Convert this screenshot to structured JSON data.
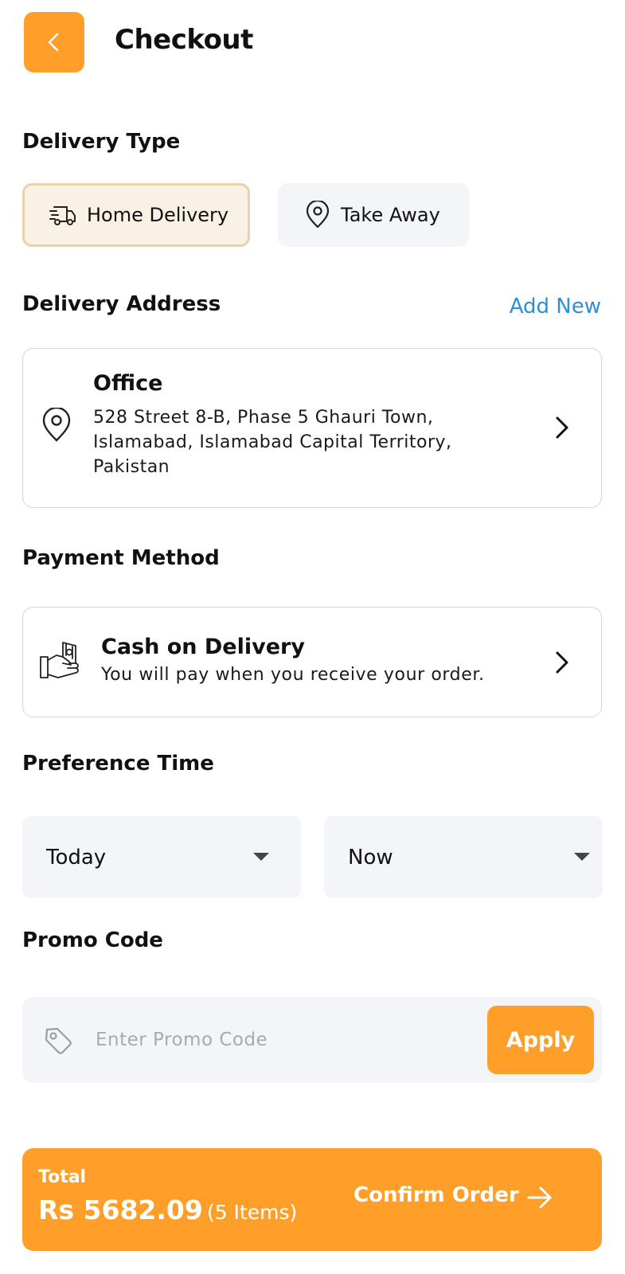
{
  "header": {
    "title": "Checkout"
  },
  "delivery_type": {
    "heading": "Delivery Type",
    "options": [
      {
        "label": "Home Delivery",
        "icon": "delivery-truck-icon",
        "selected": true
      },
      {
        "label": "Take Away",
        "icon": "location-pin-icon",
        "selected": false
      }
    ]
  },
  "delivery_address": {
    "heading": "Delivery Address",
    "add_new": "Add New",
    "name": "Office",
    "line1": "528 Street 8-B, Phase 5 Ghauri Town,",
    "line2": "Islamabad, Islamabad Capital Territory,",
    "line3": "Pakistan"
  },
  "payment": {
    "heading": "Payment Method",
    "title": "Cash on Delivery",
    "description": "You will pay when you receive your order."
  },
  "preference_time": {
    "heading": "Preference Time",
    "day": "Today",
    "time": "Now"
  },
  "promo": {
    "heading": "Promo Code",
    "placeholder": "Enter Promo Code",
    "apply_label": "Apply"
  },
  "footer": {
    "total_label": "Total",
    "total_amount": "Rs 5682.09",
    "items_count": "(5 Items)",
    "confirm_label": "Confirm Order"
  },
  "colors": {
    "accent": "#FF9F29",
    "link": "#2E8FD6",
    "muted_bg": "#F4F5F9",
    "selected_bg": "#FAF1E5"
  }
}
